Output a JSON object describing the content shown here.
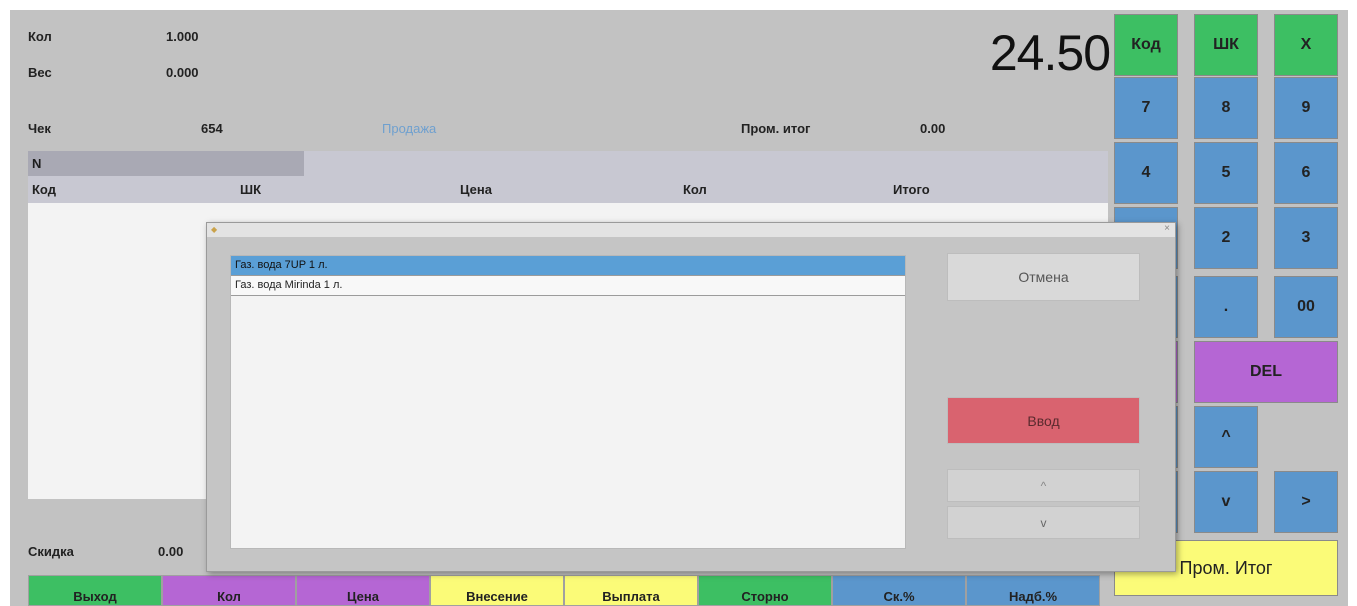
{
  "info": {
    "qty_label": "Кол",
    "qty_value": "1.000",
    "weight_label": "Вес",
    "weight_value": "0.000",
    "receipt_label": "Чек",
    "receipt_value": "654",
    "mode": "Продажа",
    "subtotal_label": "Пром. итог",
    "subtotal_value": "0.00",
    "total": "24.50"
  },
  "table": {
    "n_label": "N",
    "columns": [
      "Код",
      "ШК",
      "Цена",
      "Кол",
      "Итого"
    ]
  },
  "footer": {
    "discount_label": "Скидка",
    "discount_value": "0.00"
  },
  "bottom_buttons": [
    {
      "label": "Выход",
      "color": "#3dbf63"
    },
    {
      "label": "Кол",
      "color": "#b566d4"
    },
    {
      "label": "Цена",
      "color": "#b566d4"
    },
    {
      "label": "Внесение",
      "color": "#fbfb78"
    },
    {
      "label": "Выплата",
      "color": "#fbfb78"
    },
    {
      "label": "Сторно",
      "color": "#3dbf63"
    },
    {
      "label": "Ск.%",
      "color": "#5b96cc"
    },
    {
      "label": "Надб.%",
      "color": "#5b96cc"
    }
  ],
  "keypad": {
    "code": "Код",
    "barcode": "ШК",
    "clear": "X",
    "k7": "7",
    "k8": "8",
    "k9": "9",
    "k4": "4",
    "k5": "5",
    "k6": "6",
    "k2": "2",
    "k3": "3",
    "dot": ".",
    "k00": "00",
    "del": "DEL",
    "up": "^",
    "down": "v",
    "right": ">",
    "subtotal": "Пром. Итог"
  },
  "dialog": {
    "close_icon": "×",
    "items": [
      "Газ. вода 7UP 1 л.",
      "Газ. вода Mirinda 1 л."
    ],
    "cancel": "Отмена",
    "enter": "Ввод",
    "up": "^",
    "down": "v"
  },
  "colors": {
    "green": "#3dbf63",
    "blue": "#5b96cc",
    "purple": "#b566d4",
    "yellow": "#fbfb78",
    "enter": "#d9636f",
    "selected": "#5a9fd6"
  }
}
